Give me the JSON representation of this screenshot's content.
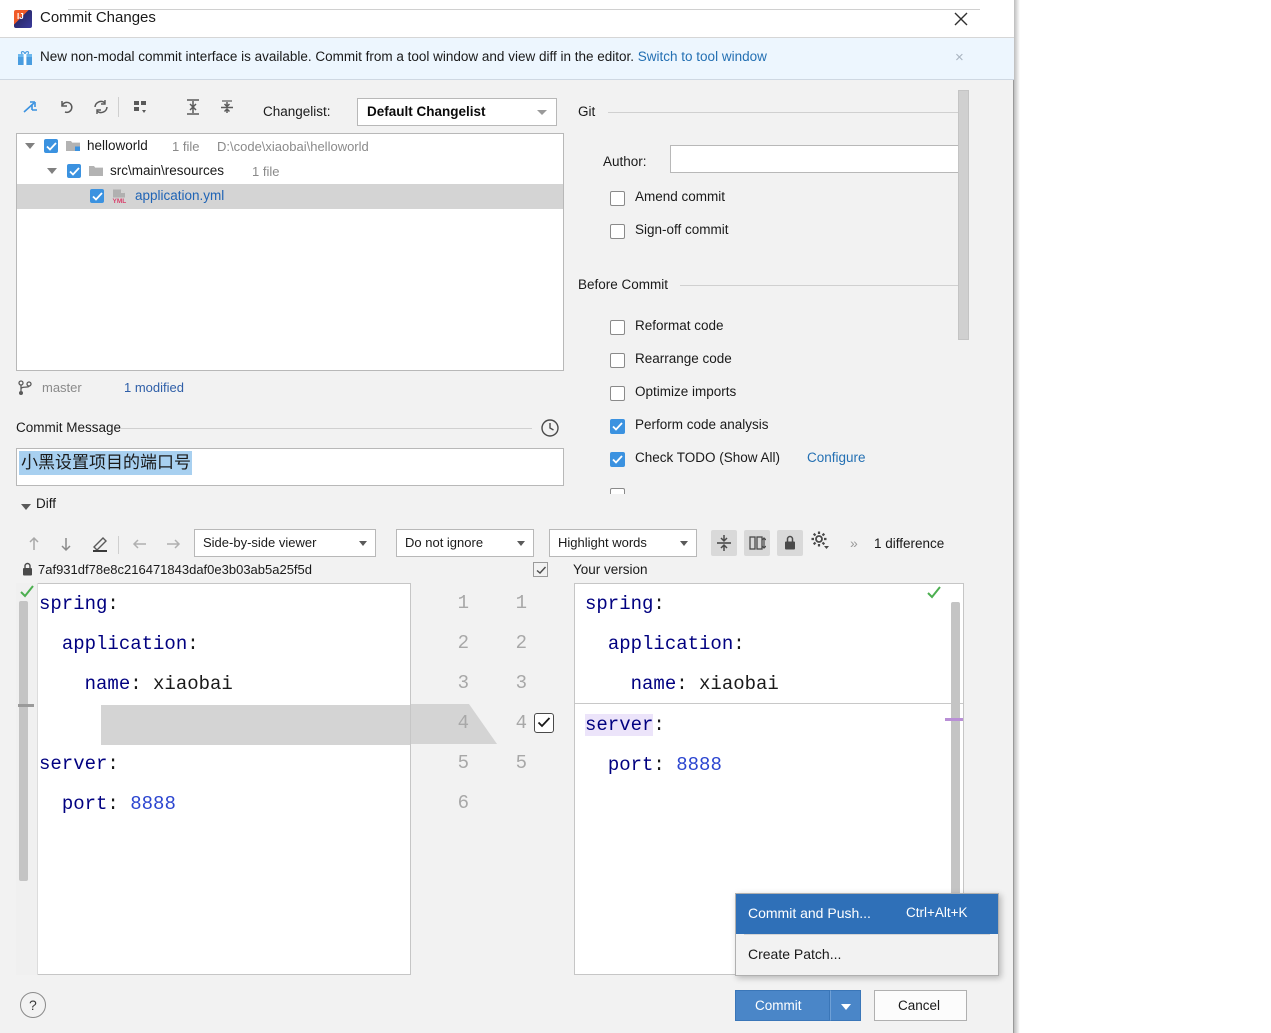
{
  "window": {
    "title": "Commit Changes",
    "app_icon": "intellij-idea-icon",
    "close_icon": "close-icon"
  },
  "banner": {
    "icon": "gift-icon",
    "message": "New non-modal commit interface is available. Commit from a tool window and view diff in the editor.",
    "link": "Switch to tool window",
    "close": "×"
  },
  "toolbar": {
    "buttons": [
      {
        "name": "include-into-commit-icon",
        "title": "Include into commit"
      },
      {
        "name": "rollback-icon",
        "title": "Rollback"
      },
      {
        "name": "refresh-icon",
        "title": "Refresh"
      },
      {
        "name": "group-by-icon",
        "title": "Group by"
      },
      {
        "name": "expand-all-icon",
        "title": "Expand all"
      },
      {
        "name": "collapse-all-icon",
        "title": "Collapse all"
      }
    ],
    "changelist_label": "Changelist:",
    "changelist_value": "Default Changelist"
  },
  "tree": {
    "rows": [
      {
        "label": "helloworld",
        "file_count": "1 file",
        "path": "D:\\code\\xiaobai\\helloworld",
        "depth": 0,
        "checked": true,
        "expanded": true,
        "icon": "module-folder-icon",
        "selected": false,
        "blue": false
      },
      {
        "label": "src\\main\\resources",
        "file_count": "1 file",
        "path": "",
        "depth": 1,
        "checked": true,
        "expanded": true,
        "icon": "folder-icon",
        "selected": false,
        "blue": false
      },
      {
        "label": "application.yml",
        "file_count": "",
        "path": "",
        "depth": 2,
        "checked": true,
        "expanded": false,
        "icon": "yml-file-icon",
        "selected": true,
        "blue": true
      }
    ]
  },
  "branch": {
    "icon": "branch-icon",
    "name": "master",
    "modified": "1 modified"
  },
  "commit_message": {
    "title": "Commit Message",
    "history_icon": "clock-icon",
    "value": "小黑设置项目的端口号",
    "selected": true
  },
  "git_options": {
    "group_title": "Git",
    "author_label": "Author:",
    "author_value": "",
    "checkboxes": [
      {
        "label": "Amend commit",
        "checked": false
      },
      {
        "label": "Sign-off commit",
        "checked": false
      }
    ]
  },
  "before_commit": {
    "group_title": "Before Commit",
    "checkboxes": [
      {
        "label": "Reformat code",
        "checked": false
      },
      {
        "label": "Rearrange code",
        "checked": false
      },
      {
        "label": "Optimize imports",
        "checked": false
      },
      {
        "label": "Perform code analysis",
        "checked": true
      },
      {
        "label": "Check TODO (Show All)",
        "checked": true,
        "link": "Configure"
      }
    ]
  },
  "diff": {
    "section_label": "Diff",
    "nav_icons": [
      {
        "name": "previous-difference-icon"
      },
      {
        "name": "next-difference-icon"
      },
      {
        "name": "edit-icon"
      },
      {
        "name": "apply-left-icon"
      },
      {
        "name": "apply-right-icon"
      }
    ],
    "viewer_mode": "Side-by-side viewer",
    "ignore_mode": "Do not ignore",
    "highlight_mode": "Highlight words",
    "toggles": [
      {
        "name": "collapse-unchanged-icon",
        "pressed": true
      },
      {
        "name": "synchronize-scrolling-icon",
        "pressed": true
      },
      {
        "name": "lock-icon",
        "pressed": true
      }
    ],
    "settings_icon": "gear-icon",
    "expand_icon": "double-chevron-right-icon",
    "difference_count": "1 difference",
    "left_header": {
      "lock_icon": "lock-icon",
      "revision": "7af931df78e8c216471843daf0e3b03ab5a25f5d"
    },
    "center_checkbox_checked": true,
    "right_header": "Your version"
  },
  "code": {
    "left_lines": [
      {
        "indent": 0,
        "key": "spring",
        "value": "",
        "line_no": 1
      },
      {
        "indent": 1,
        "key": "application",
        "value": "",
        "line_no": 2
      },
      {
        "indent": 2,
        "key": "name",
        "value": "xiaobai",
        "line_no": 3
      },
      {
        "indent": 0,
        "key": "",
        "value": "",
        "line_no": 4,
        "gap": true
      },
      {
        "indent": 0,
        "key": "server",
        "value": "",
        "line_no": 5
      },
      {
        "indent": 1,
        "key": "port",
        "value": "8888",
        "line_no": 6
      }
    ],
    "right_lines": [
      {
        "indent": 0,
        "key": "spring",
        "value": "",
        "line_no": 1
      },
      {
        "indent": 1,
        "key": "application",
        "value": "",
        "line_no": 2
      },
      {
        "indent": 2,
        "key": "name",
        "value": "xiaobai",
        "line_no": 3
      },
      {
        "indent": 0,
        "key": "server",
        "value": "",
        "line_no": 4,
        "highlight": true
      },
      {
        "indent": 1,
        "key": "port",
        "value": "8888",
        "line_no": 5
      }
    ],
    "gutter_left_numbers": [
      "1",
      "2",
      "3",
      "4",
      "5",
      "6"
    ],
    "gutter_right_numbers": [
      "1",
      "2",
      "3",
      "4",
      "5"
    ],
    "changed_line_checkbox": true
  },
  "context_menu": {
    "items": [
      {
        "label": "Commit and Push...",
        "shortcut": "Ctrl+Alt+K",
        "highlighted": true
      },
      {
        "label": "Create Patch...",
        "shortcut": "",
        "highlighted": false
      }
    ]
  },
  "footer": {
    "help_label": "?",
    "commit_label": "Commit",
    "cancel_label": "Cancel"
  },
  "colors": {
    "accent": "#4a86c8",
    "link": "#2470b3",
    "checkbox_on": "#3b92e0",
    "selection": "#a8d0f0",
    "menu_highlight": "#2f70b8",
    "banner_bg": "#edf6fe"
  }
}
